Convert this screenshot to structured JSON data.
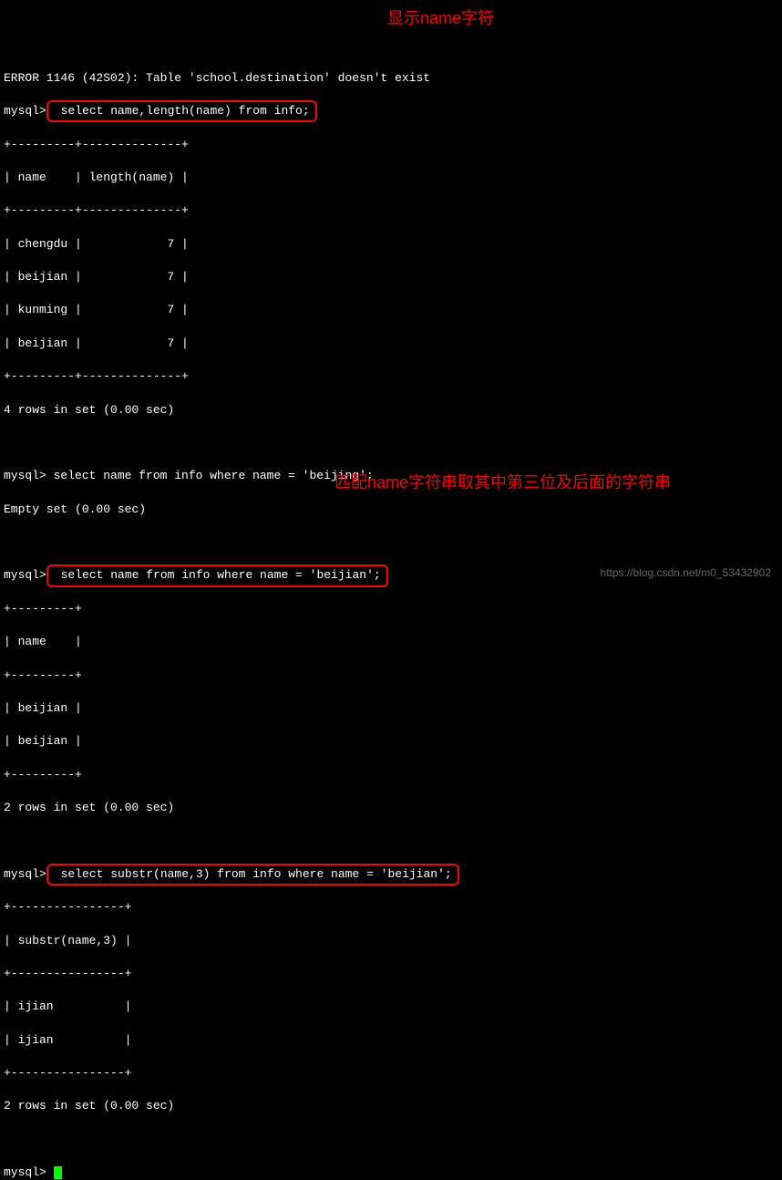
{
  "error_line": "ERROR 1146 (42S02): Table 'school.destination' doesn't exist",
  "prompts": {
    "p1": "mysql>",
    "p2": "mysql>",
    "p3": "mysql>",
    "p4": "mysql>",
    "p5": "mysql> "
  },
  "queries": {
    "q1": " select name,length(name) from info;",
    "q2": " select name from info where name = 'beijing';",
    "q3": " select name from info where name = 'beijian';",
    "q4": " select substr(name,3) from info where name = 'beijian';"
  },
  "tables": {
    "t1": {
      "border": "+---------+--------------+",
      "header": "| name    | length(name) |",
      "rows": [
        "| chengdu |            7 |",
        "| beijian |            7 |",
        "| kunming |            7 |",
        "| beijian |            7 |"
      ],
      "footer": "4 rows in set (0.00 sec)"
    },
    "t2_empty": "Empty set (0.00 sec)",
    "t3": {
      "border": "+---------+",
      "header": "| name    |",
      "rows": [
        "| beijian |",
        "| beijian |"
      ],
      "footer": "2 rows in set (0.00 sec)"
    },
    "t4": {
      "border": "+----------------+",
      "header": "| substr(name,3) |",
      "rows": [
        "| ijian          |",
        "| ijian          |"
      ],
      "footer": "2 rows in set (0.00 sec)"
    }
  },
  "annotations": {
    "a1": "显示name字符",
    "a2": "匹配name字符串取其中第三位及后面的字符串"
  },
  "watermark": "https://blog.csdn.net/m0_53432902"
}
